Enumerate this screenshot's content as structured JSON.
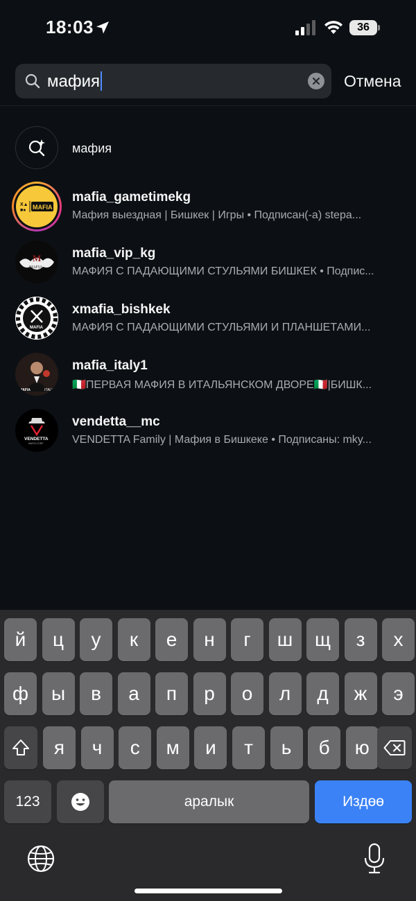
{
  "status_bar": {
    "time": "18:03",
    "battery": "36"
  },
  "search": {
    "query": "мафия",
    "cancel_label": "Отмена"
  },
  "suggestion": {
    "label": "мафия"
  },
  "results": [
    {
      "username": "mafia_gametimekg",
      "subtitle": "Мафия выездная | Бишкек | Игры • Подписан(-а) stepa...",
      "avatar_text": "MAFIA",
      "has_story": true
    },
    {
      "username": "mafia_vip_kg",
      "subtitle": "МАФИЯ С ПАДАЮЩИМИ СТУЛЬЯМИ БИШКЕК • Подпис...",
      "avatar_text": "MAFIA",
      "has_story": false
    },
    {
      "username": "xmafia_bishkek",
      "subtitle": "МАФИЯ С ПАДАЮЩИМИ СТУЛЬЯМИ И ПЛАНШЕТАМИ...",
      "avatar_text": "MAFIA",
      "has_story": false
    },
    {
      "username": "mafia_italy1",
      "subtitle": "🇮🇹ПЕРВАЯ МАФИЯ В ИТАЛЬЯНСКОМ ДВОРЕ🇮🇹|БИШК...",
      "avatar_text": "MAFIA ITALY",
      "has_story": false
    },
    {
      "username": "vendetta__mc",
      "subtitle": "VENDETTA Family | Мафия в Бишкеке • Подписаны: mky...",
      "avatar_text": "VENDETTA",
      "has_story": false
    }
  ],
  "keyboard": {
    "row1": [
      "й",
      "ц",
      "у",
      "к",
      "е",
      "н",
      "г",
      "ш",
      "щ",
      "з",
      "х"
    ],
    "row2": [
      "ф",
      "ы",
      "в",
      "а",
      "п",
      "р",
      "о",
      "л",
      "д",
      "ж",
      "э"
    ],
    "row3": [
      "я",
      "ч",
      "с",
      "м",
      "и",
      "т",
      "ь",
      "б",
      "ю"
    ],
    "numbers_label": "123",
    "space_label": "аралык",
    "return_label": "Издөө"
  },
  "colors": {
    "background": "#0c1014",
    "search_field": "#262a2f",
    "return_key": "#3b82f6",
    "key": "#6b6b6e"
  }
}
